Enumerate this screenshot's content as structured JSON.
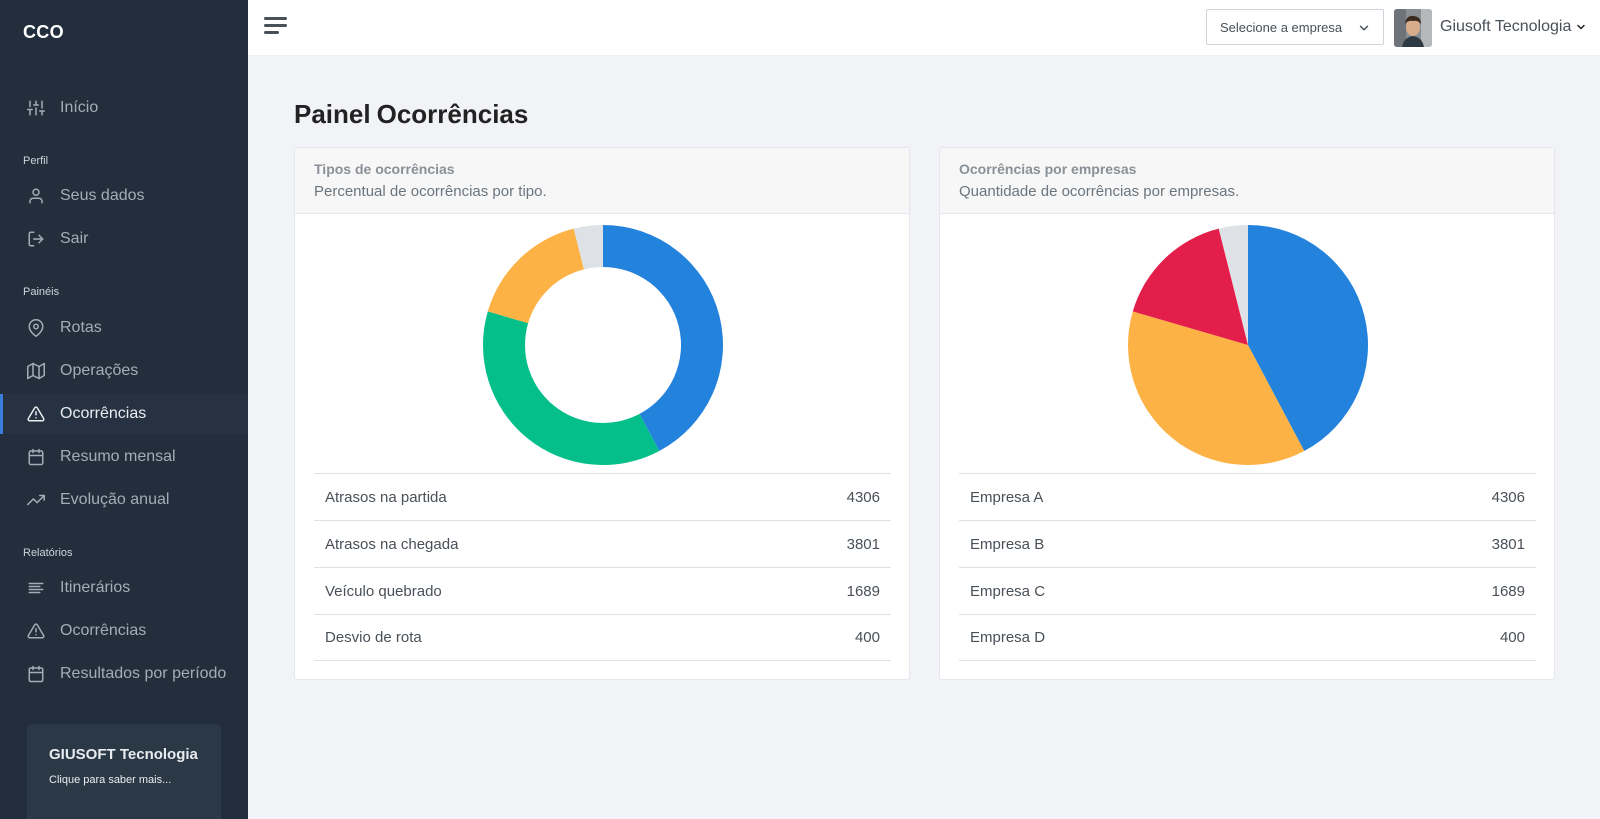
{
  "app": {
    "brand": "CCO"
  },
  "sidebar": {
    "sections": {
      "perfil": "Perfil",
      "paineis": "Painéis",
      "relatorios": "Relatórios"
    },
    "items": {
      "inicio": "Início",
      "seus_dados": "Seus dados",
      "sair": "Sair",
      "rotas": "Rotas",
      "operacoes": "Operações",
      "ocorrencias": "Ocorrências",
      "resumo_mensal": "Resumo mensal",
      "evolucao_anual": "Evolução anual",
      "itinerarios": "Itinerários",
      "ocorrencias_rel": "Ocorrências",
      "resultados": "Resultados por período"
    },
    "cta": {
      "title": "GIUSOFT Tecnologia",
      "subtitle": "Clique para saber mais..."
    }
  },
  "topbar": {
    "company_placeholder": "Selecione a empresa",
    "user_name": "Giusoft Tecnologia"
  },
  "page": {
    "title_bold": "Painel",
    "title_rest": "Ocorrências"
  },
  "cards": [
    {
      "title": "Tipos de ocorrências",
      "subtitle": "Percentual de ocorrências por tipo.",
      "rows": [
        {
          "label": "Atrasos na partida",
          "value": "4306"
        },
        {
          "label": "Atrasos na chegada",
          "value": "3801"
        },
        {
          "label": "Veículo quebrado",
          "value": "1689"
        },
        {
          "label": "Desvio de rota",
          "value": "400"
        }
      ]
    },
    {
      "title": "Ocorrências por empresas",
      "subtitle": "Quantidade de ocorrências por empresas.",
      "rows": [
        {
          "label": "Empresa A",
          "value": "4306"
        },
        {
          "label": "Empresa B",
          "value": "3801"
        },
        {
          "label": "Empresa C",
          "value": "1689"
        },
        {
          "label": "Empresa D",
          "value": "400"
        }
      ]
    }
  ],
  "chart_data": [
    {
      "type": "pie",
      "variant": "doughnut",
      "categories": [
        "Atrasos na partida",
        "Atrasos na chegada",
        "Veículo quebrado",
        "Desvio de rota"
      ],
      "values": [
        4306,
        3801,
        1689,
        400
      ],
      "colors": [
        "#2382dc",
        "#04bf8a",
        "#fdb246",
        "#dee2e6"
      ]
    },
    {
      "type": "pie",
      "categories": [
        "Empresa A",
        "Empresa B",
        "Empresa C",
        "Empresa D"
      ],
      "values": [
        4306,
        3801,
        1689,
        400
      ],
      "colors": [
        "#2382dc",
        "#fdb246",
        "#e41e4a",
        "#dee2e6"
      ]
    }
  ]
}
